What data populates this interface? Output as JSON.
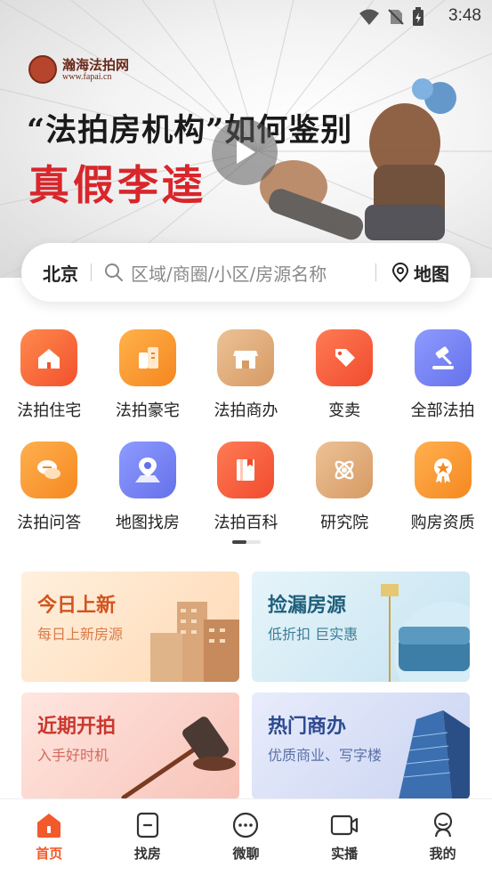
{
  "status_bar": {
    "time": "3:48"
  },
  "banner": {
    "brand_name": "瀚海法拍网",
    "brand_url": "www.fapai.cn",
    "headline": "“法拍房机构”如何鉴别",
    "subheadline": "真假李逵"
  },
  "search": {
    "city": "北京",
    "placeholder": "区域/商圈/小区/房源名称",
    "map_label": "地图"
  },
  "categories": [
    {
      "label": "法拍住宅",
      "icon": "house-icon",
      "color_from": "#ff8a4d",
      "color_to": "#f2512d"
    },
    {
      "label": "法拍豪宅",
      "icon": "building-icon",
      "color_from": "#ffb24a",
      "color_to": "#f5861f"
    },
    {
      "label": "法拍商办",
      "icon": "storefront-icon",
      "color_from": "#ecc297",
      "color_to": "#d69a63"
    },
    {
      "label": "变卖",
      "icon": "tag-icon",
      "color_from": "#ff7b55",
      "color_to": "#f04b2d"
    },
    {
      "label": "全部法拍",
      "icon": "gavel-icon",
      "color_from": "#8e9bff",
      "color_to": "#6571ea"
    },
    {
      "label": "法拍问答",
      "icon": "chat-icon",
      "color_from": "#ffb04f",
      "color_to": "#f58820"
    },
    {
      "label": "地图找房",
      "icon": "map-pin-icon",
      "color_from": "#8e9bff",
      "color_to": "#6571ea"
    },
    {
      "label": "法拍百科",
      "icon": "book-icon",
      "color_from": "#ff7b55",
      "color_to": "#f04b2d"
    },
    {
      "label": "研究院",
      "icon": "atom-icon",
      "color_from": "#ecc297",
      "color_to": "#d69a63"
    },
    {
      "label": "购房资质",
      "icon": "medal-icon",
      "color_from": "#ffb04f",
      "color_to": "#f58820"
    }
  ],
  "cards": [
    {
      "title": "今日上新",
      "subtitle": "每日上新房源",
      "title_color": "#d2541e",
      "sub_color": "#d97a4a"
    },
    {
      "title": "捡漏房源",
      "subtitle": "低折扣 巨实惠",
      "title_color": "#1f5f7a",
      "sub_color": "#3c7d97"
    },
    {
      "title": "近期开拍",
      "subtitle": "入手好时机",
      "title_color": "#c8392e",
      "sub_color": "#d26a5e"
    },
    {
      "title": "热门商办",
      "subtitle": "优质商业、写字楼",
      "title_color": "#2d4a8f",
      "sub_color": "#5a70a6"
    }
  ],
  "bottom_nav": [
    {
      "label": "首页",
      "icon": "home-icon",
      "active": true
    },
    {
      "label": "找房",
      "icon": "phone-search-icon",
      "active": false
    },
    {
      "label": "微聊",
      "icon": "chat-bubble-icon",
      "active": false
    },
    {
      "label": "实播",
      "icon": "video-camera-icon",
      "active": false
    },
    {
      "label": "我的",
      "icon": "user-icon",
      "active": false
    }
  ],
  "accent_color": "#f25a2b"
}
